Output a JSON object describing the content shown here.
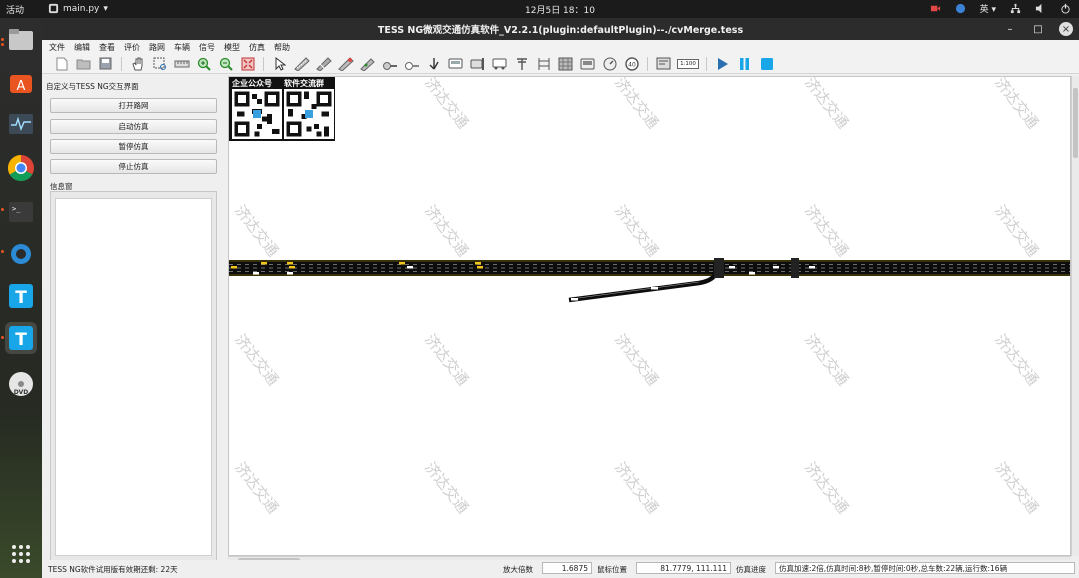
{
  "topbar": {
    "activities": "活动",
    "app_name": "main.py",
    "clock": "12月5日  18：10",
    "ime": "英"
  },
  "window": {
    "title": "TESS NG微观交通仿真软件_V2.2.1(plugin:defaultPlugin)--./cvMerge.tess"
  },
  "menu": [
    "文件",
    "编辑",
    "查看",
    "评价",
    "路网",
    "车辆",
    "信号",
    "模型",
    "仿真",
    "帮助"
  ],
  "toolbar": {
    "scale_label": "1:100",
    "speed_label": "40"
  },
  "leftpanel": {
    "title": "自定义与TESS NG交互界面",
    "buttons": [
      "打开路网",
      "启动仿真",
      "暂停仿真",
      "停止仿真"
    ],
    "info_label": "信息窗"
  },
  "canvas": {
    "qr_labels": [
      "企业公众号",
      "软件交流群"
    ],
    "watermark": "济达交通"
  },
  "statusbar": {
    "license": "TESS NG软件试用版有效期还剩:  22天",
    "zoom_label": "放大倍数",
    "zoom_value": "1.6875",
    "mouse_label": "鼠标位置",
    "mouse_value": "81.7779, 111.111",
    "progress_label": "仿真进度",
    "progress_value": "仿真加速:2倍,仿真时间:8秒,暂停时间:0秒,总车数:22辆,运行数:16辆"
  },
  "colors": {
    "accent": "#e95420",
    "play": "#2a6fb0",
    "road": "#0d0d0d",
    "vehicle": "#f3c21b"
  }
}
